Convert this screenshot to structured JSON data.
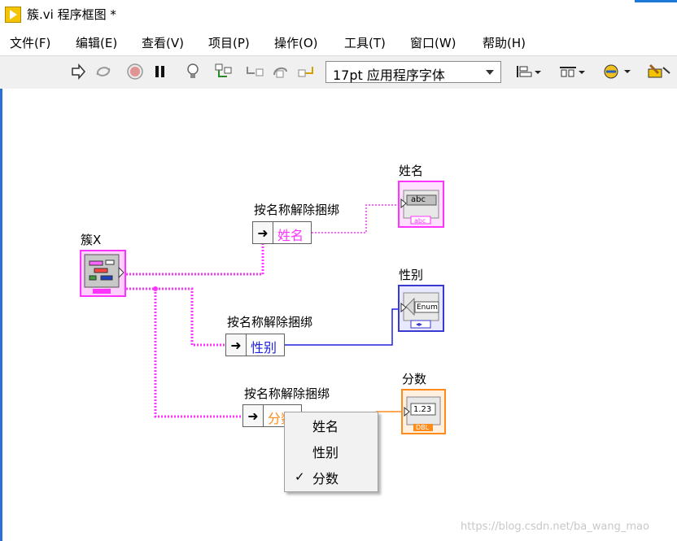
{
  "window": {
    "title": "簇.vi 程序框图 *"
  },
  "menu": [
    "文件(F)",
    "编辑(E)",
    "查看(V)",
    "项目(P)",
    "操作(O)",
    "工具(T)",
    "窗口(W)",
    "帮助(H)"
  ],
  "toolbar": {
    "font_select": "17pt 应用程序字体",
    "icons": [
      "run-arrow-icon",
      "run-continuously-icon",
      "abort-icon",
      "pause-icon",
      "highlight-execution-icon",
      "retain-wire-values-icon",
      "step-into-icon",
      "step-over-icon",
      "step-out-icon",
      "align-objects-icon",
      "distribute-objects-icon",
      "reorder-icon",
      "cleanup-diagram-icon"
    ]
  },
  "diagram": {
    "cluster": {
      "label": "簇X",
      "color": "#ff33ff"
    },
    "unbundle_nodes": [
      {
        "label": "按名称解除捆绑",
        "field": "姓名",
        "field_color": "#ff33ff"
      },
      {
        "label": "按名称解除捆绑",
        "field": "性别",
        "field_color": "#2020e0"
      },
      {
        "label": "按名称解除捆绑",
        "field": "分数",
        "field_color": "#ff8c1a"
      }
    ],
    "indicators": [
      {
        "label": "姓名",
        "inner": "abc",
        "type_text": "abc",
        "color": "#ff33ff"
      },
      {
        "label": "性别",
        "inner": "Enum",
        "type_text": "◂▸",
        "color": "#3a3ad0"
      },
      {
        "label": "分数",
        "inner": "1.23",
        "type_text": "DBL",
        "color": "#ff8c1a"
      }
    ]
  },
  "context_menu": {
    "items": [
      {
        "label": "姓名",
        "checked": false
      },
      {
        "label": "性别",
        "checked": false
      },
      {
        "label": "分数",
        "checked": true
      }
    ]
  },
  "watermark": "https://blog.csdn.net/ba_wang_mao"
}
